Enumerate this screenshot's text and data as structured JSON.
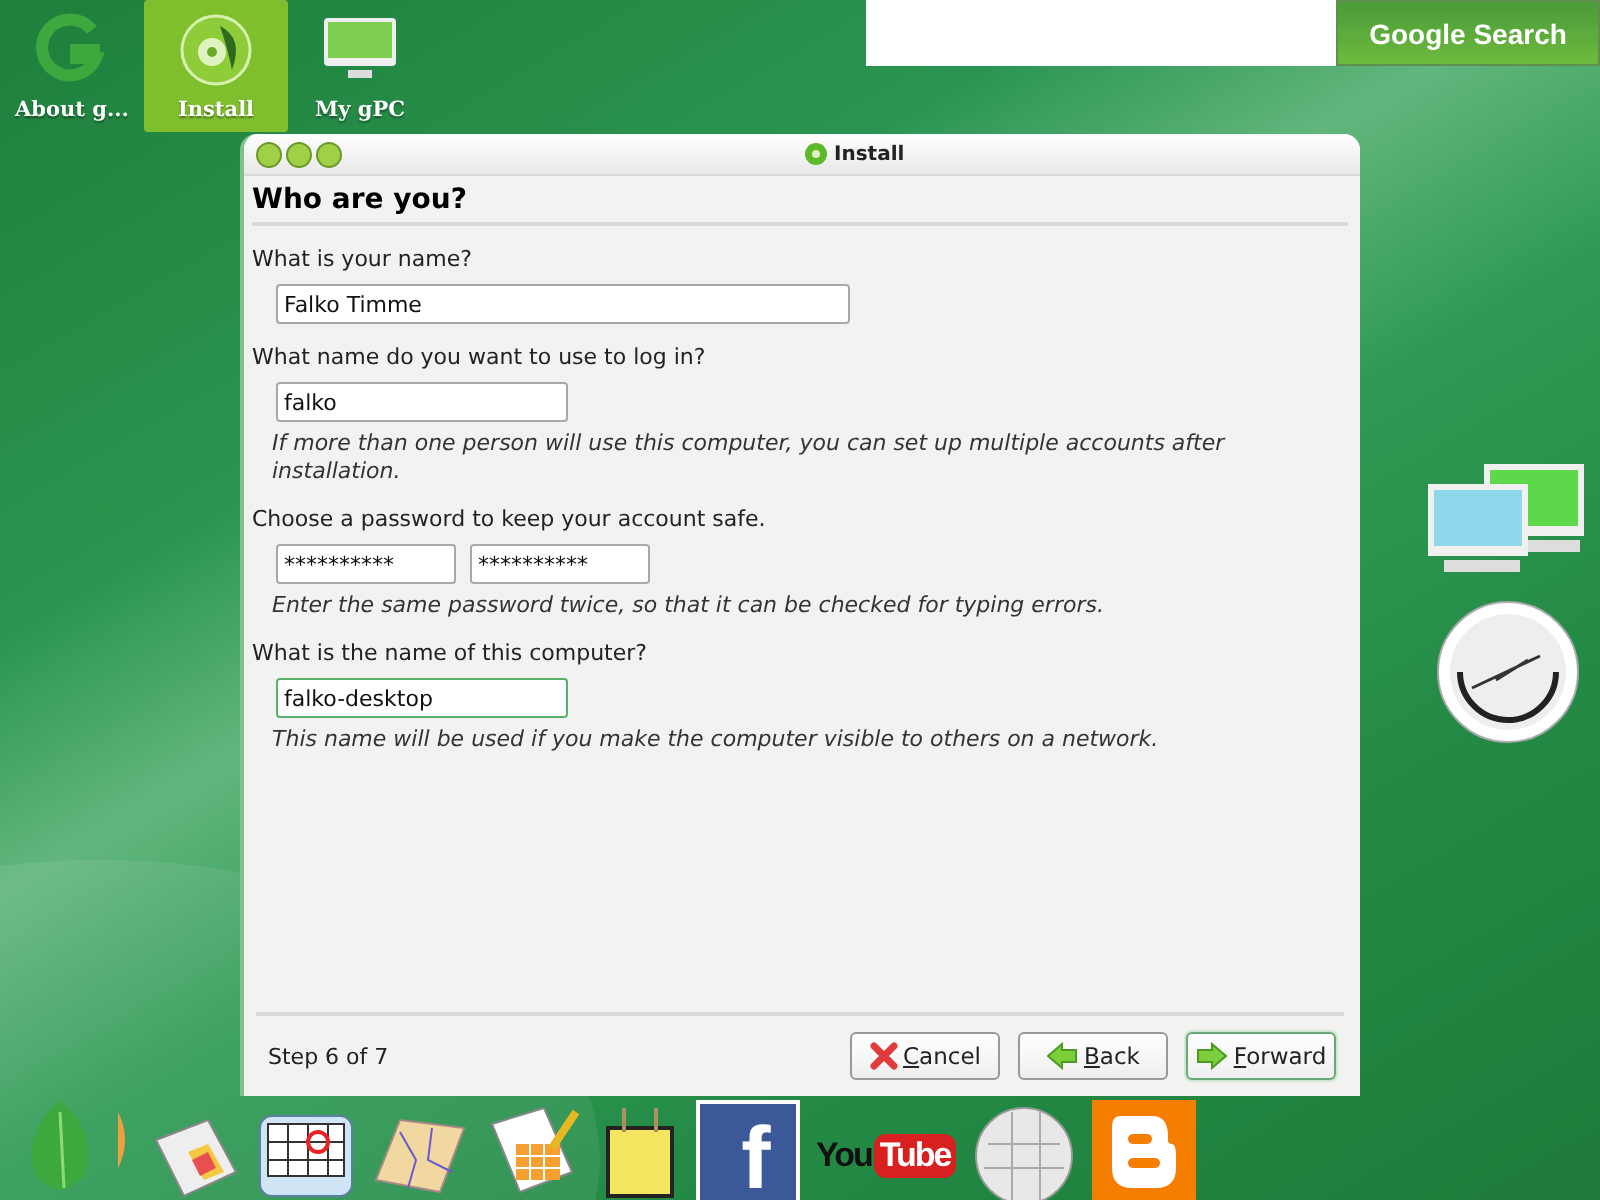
{
  "desktop_icons": [
    {
      "label": "About g...",
      "kind": "g",
      "selected": false
    },
    {
      "label": "Install",
      "kind": "disc",
      "selected": true
    },
    {
      "label": "My gPC",
      "kind": "monitor",
      "selected": false
    }
  ],
  "search": {
    "button": "Google Search"
  },
  "window": {
    "title": "Install",
    "heading": "Who are you?",
    "sections": [
      {
        "label": "What is your name?",
        "inputs": [
          {
            "value": "Falko Timme",
            "kind": "wide",
            "focused": false
          }
        ]
      },
      {
        "label": "What name do you want to use to log in?",
        "inputs": [
          {
            "value": "falko",
            "kind": "medium",
            "focused": false
          }
        ],
        "hint": "If more than one person will use this computer, you can set up multiple accounts after installation."
      },
      {
        "label": "Choose a password to keep your account safe.",
        "inputs": [
          {
            "value": "**********",
            "kind": "small",
            "focused": false
          },
          {
            "value": "**********",
            "kind": "small",
            "focused": false
          }
        ],
        "hint": "Enter the same password twice, so that it can be checked for typing errors."
      },
      {
        "label": "What is the name of this computer?",
        "inputs": [
          {
            "value": "falko-desktop",
            "kind": "medium",
            "focused": true
          }
        ],
        "hint": "This name will be used if you make the computer visible to others on a network."
      }
    ],
    "step": "Step 6 of 7",
    "buttons": [
      {
        "label": "Cancel",
        "kind": "cancel",
        "default": false
      },
      {
        "label": "Back",
        "kind": "back",
        "default": false
      },
      {
        "label": "Forward",
        "kind": "forward",
        "default": true
      }
    ]
  },
  "widgets": [
    {
      "kind": "network"
    },
    {
      "kind": "clock"
    }
  ],
  "dock": [
    {
      "kind": "leaf"
    },
    {
      "kind": "tab"
    },
    {
      "kind": "news"
    },
    {
      "kind": "calendar"
    },
    {
      "kind": "map"
    },
    {
      "kind": "sheet"
    },
    {
      "kind": "bag"
    },
    {
      "kind": "facebook",
      "text": "f"
    },
    {
      "kind": "youtube",
      "text": "You",
      "text2": "Tube"
    },
    {
      "kind": "wiki"
    },
    {
      "kind": "blogger"
    }
  ]
}
